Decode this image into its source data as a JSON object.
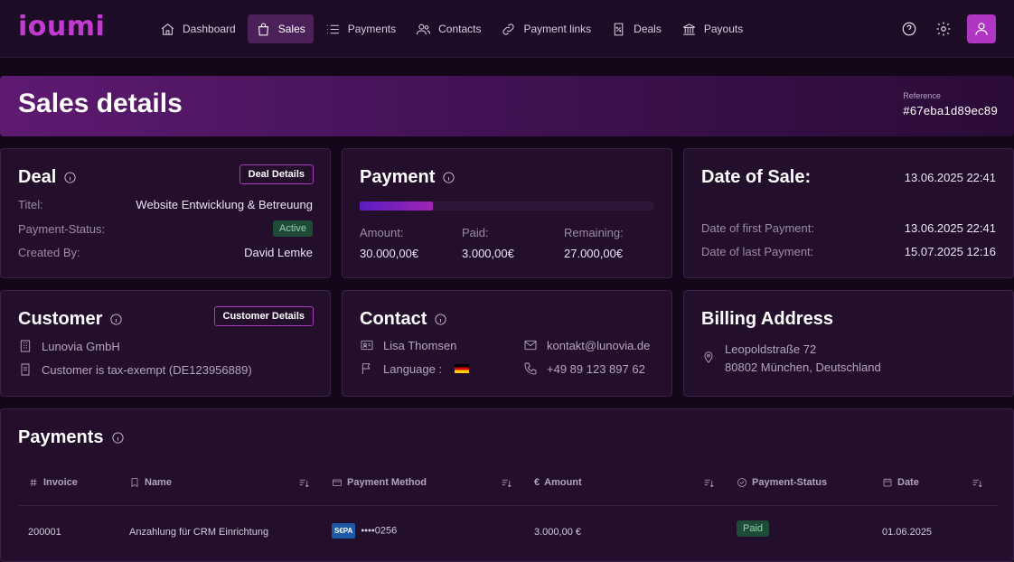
{
  "app": {
    "logo": "ioumi"
  },
  "nav": [
    {
      "label": "Dashboard",
      "icon": "home-icon",
      "active": false
    },
    {
      "label": "Sales",
      "icon": "shopping-bag-icon",
      "active": true
    },
    {
      "label": "Payments",
      "icon": "list-icon",
      "active": false
    },
    {
      "label": "Contacts",
      "icon": "users-icon",
      "active": false
    },
    {
      "label": "Payment links",
      "icon": "link-icon",
      "active": false
    },
    {
      "label": "Deals",
      "icon": "percent-receipt-icon",
      "active": false
    },
    {
      "label": "Payouts",
      "icon": "bank-icon",
      "active": false
    }
  ],
  "page": {
    "title": "Sales details",
    "reference_label": "Reference",
    "reference_value": "#67eba1d89ec89"
  },
  "deal": {
    "title": "Deal",
    "button": "Deal Details",
    "titel_label": "Titel:",
    "titel_value": "Website Entwicklung & Betreuung",
    "status_label": "Payment-Status:",
    "status_value": "Active",
    "created_label": "Created By:",
    "created_value": "David Lemke"
  },
  "payment": {
    "title": "Payment",
    "progress_fraction": 0.25,
    "amount_label": "Amount:",
    "amount_value": "30.000,00€",
    "paid_label": "Paid:",
    "paid_value": "3.000,00€",
    "remaining_label": "Remaining:",
    "remaining_value": "27.000,00€"
  },
  "date_of_sale": {
    "title": "Date of Sale:",
    "value": "13.06.2025 22:41",
    "first_label": "Date of first Payment:",
    "first_value": "13.06.2025 22:41",
    "last_label": "Date of last Payment:",
    "last_value": "15.07.2025 12:16"
  },
  "customer": {
    "title": "Customer",
    "button": "Customer Details",
    "company": "Lunovia GmbH",
    "tax": "Customer is tax-exempt (DE123956889)"
  },
  "contact": {
    "title": "Contact",
    "name": "Lisa Thomsen",
    "language_label": "Language :",
    "email": "kontakt@lunovia.de",
    "phone": "+49 89 123 897 62"
  },
  "billing": {
    "title": "Billing Address",
    "line1": "Leopoldstraße 72",
    "line2": "80802 München, Deutschland"
  },
  "payments_table": {
    "title": "Payments",
    "columns": {
      "invoice": "Invoice",
      "name": "Name",
      "method": "Payment Method",
      "amount": "Amount",
      "status": "Payment-Status",
      "date": "Date"
    },
    "rows": [
      {
        "invoice": "200001",
        "name": "Anzahlung für CRM Einrichtung",
        "method_brand": "S€PA",
        "method_mask": "••••0256",
        "amount": "3.000,00 €",
        "status": "Paid",
        "date": "01.06.2025"
      }
    ]
  },
  "colors": {
    "accent": "#b236c4",
    "background": "#14071a",
    "card": "#230f2c",
    "success_bg": "#1f4a37",
    "success_text": "#8fd4ab"
  }
}
